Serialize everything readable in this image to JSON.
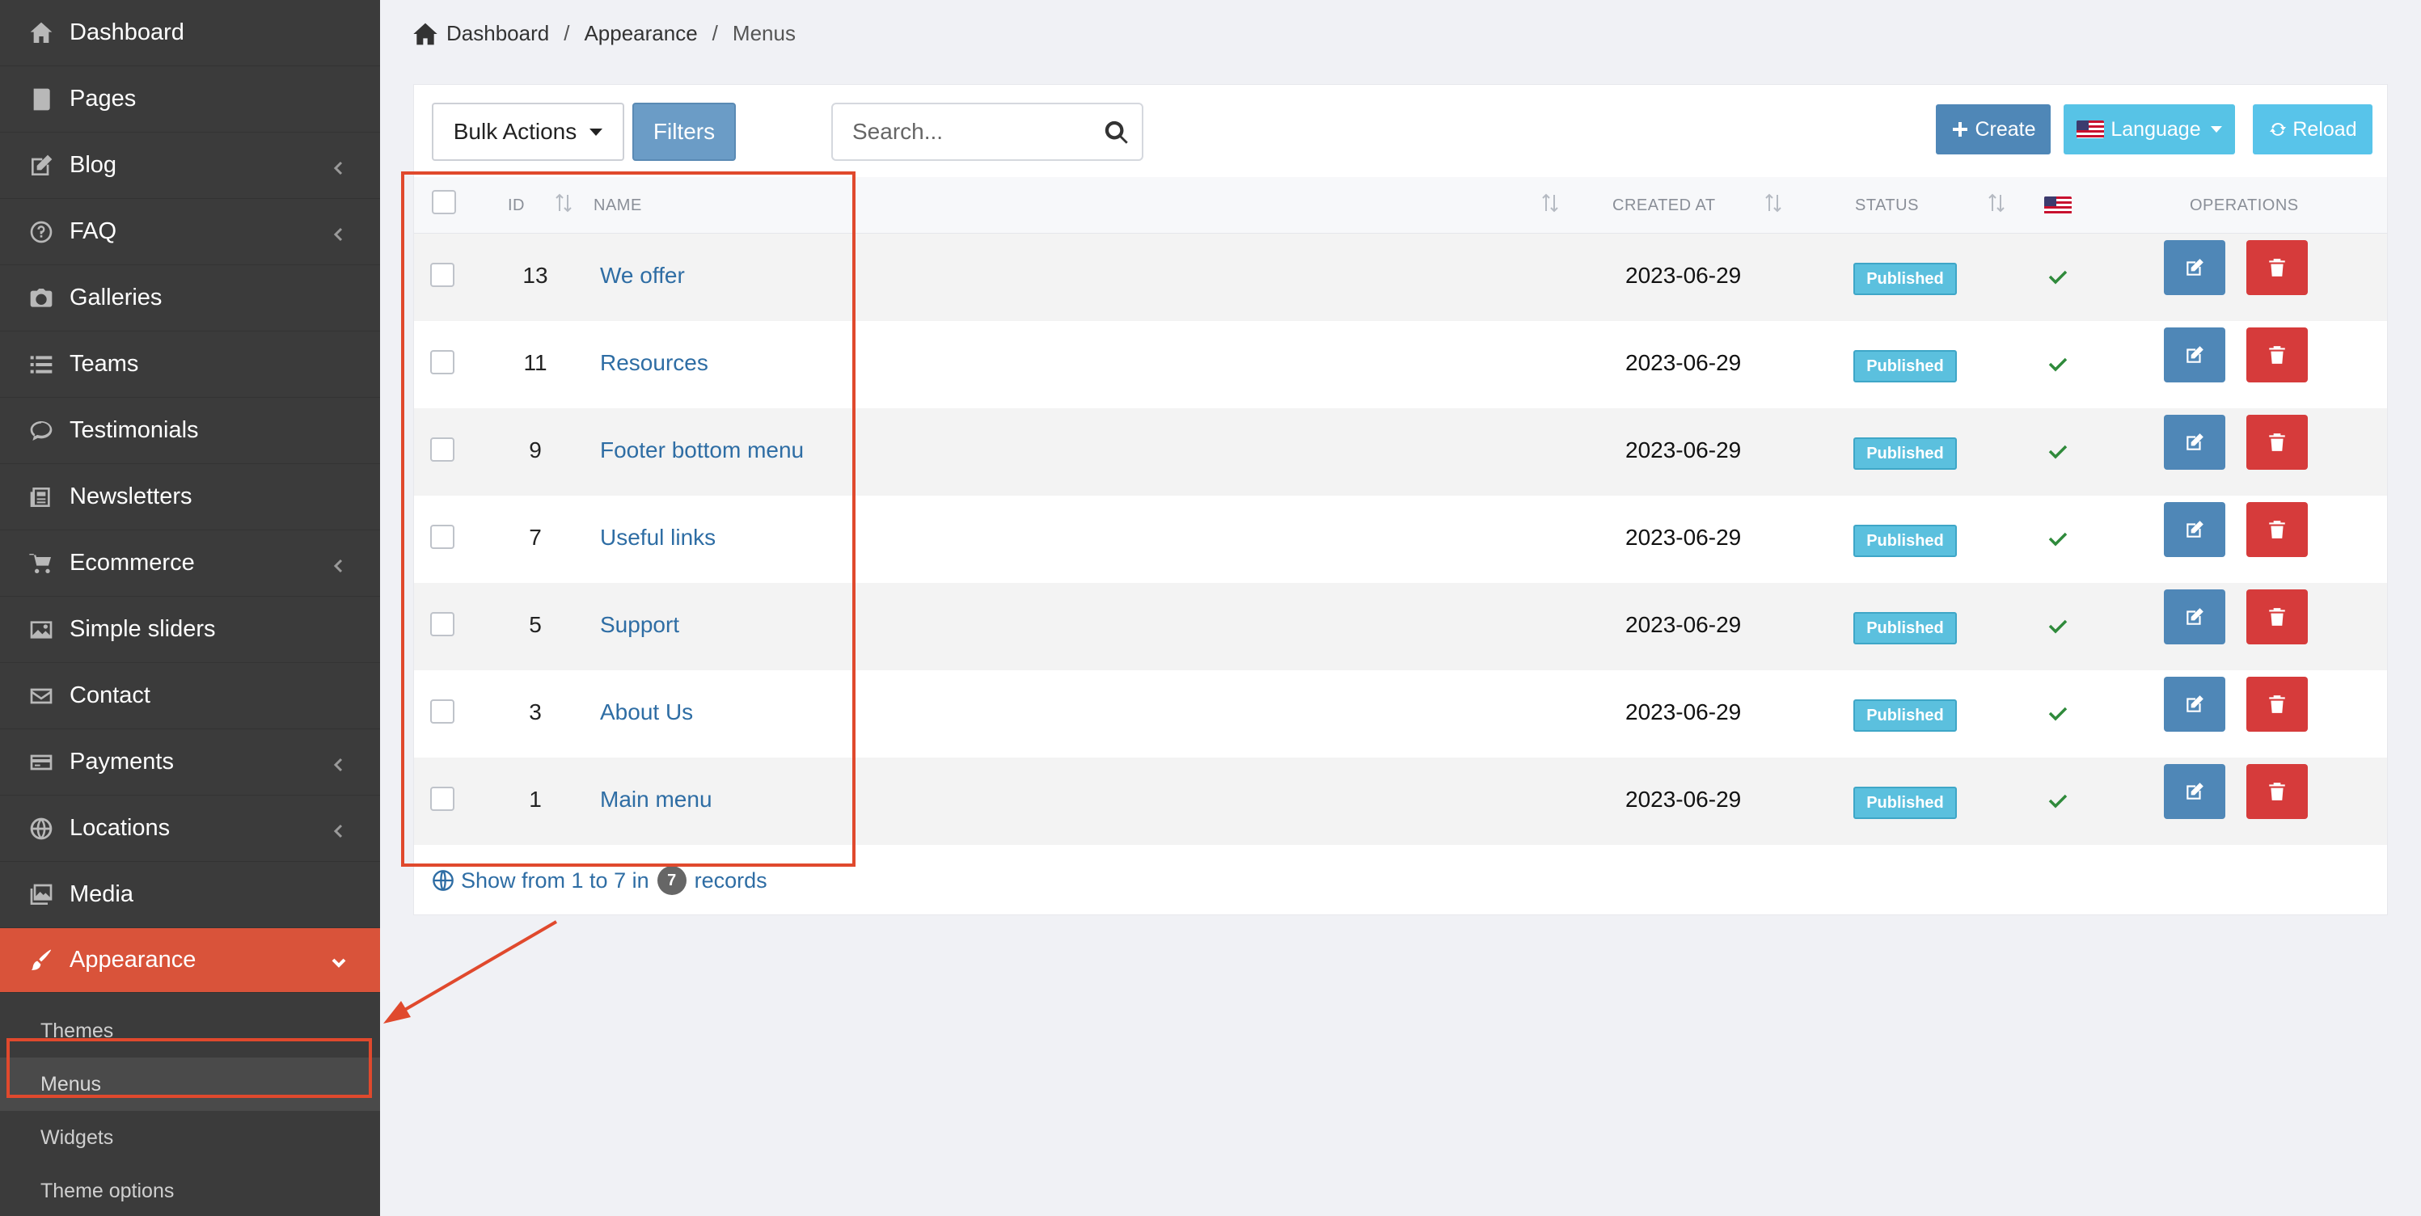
{
  "sidebar": {
    "items": [
      {
        "label": "Dashboard",
        "icon": "home-icon",
        "has_chevron": false
      },
      {
        "label": "Pages",
        "icon": "book-icon",
        "has_chevron": false
      },
      {
        "label": "Blog",
        "icon": "edit-icon",
        "has_chevron": true
      },
      {
        "label": "FAQ",
        "icon": "question-icon",
        "has_chevron": true
      },
      {
        "label": "Galleries",
        "icon": "camera-icon",
        "has_chevron": false
      },
      {
        "label": "Teams",
        "icon": "list-icon",
        "has_chevron": false
      },
      {
        "label": "Testimonials",
        "icon": "comment-icon",
        "has_chevron": false
      },
      {
        "label": "Newsletters",
        "icon": "newspaper-icon",
        "has_chevron": false
      },
      {
        "label": "Ecommerce",
        "icon": "cart-icon",
        "has_chevron": true
      },
      {
        "label": "Simple sliders",
        "icon": "image-icon",
        "has_chevron": false
      },
      {
        "label": "Contact",
        "icon": "envelope-icon",
        "has_chevron": false
      },
      {
        "label": "Payments",
        "icon": "credit-card-icon",
        "has_chevron": true
      },
      {
        "label": "Locations",
        "icon": "globe-icon",
        "has_chevron": true
      },
      {
        "label": "Media",
        "icon": "images-icon",
        "has_chevron": false
      },
      {
        "label": "Appearance",
        "icon": "paintbrush-icon",
        "has_chevron": true,
        "active": true
      }
    ],
    "submenu": [
      {
        "label": "Themes"
      },
      {
        "label": "Menus",
        "selected": true
      },
      {
        "label": "Widgets"
      },
      {
        "label": "Theme options"
      }
    ]
  },
  "breadcrumb": {
    "home": "Dashboard",
    "parent": "Appearance",
    "current": "Menus",
    "separator": "/"
  },
  "toolbar": {
    "bulk_label": "Bulk Actions",
    "filters_label": "Filters",
    "search_placeholder": "Search...",
    "create_label": "Create",
    "language_label": "Language",
    "reload_label": "Reload"
  },
  "table": {
    "headers": {
      "id": "ID",
      "name": "NAME",
      "created_at": "CREATED AT",
      "status": "STATUS",
      "operations": "OPERATIONS"
    },
    "rows": [
      {
        "id": "13",
        "name": "We offer",
        "created_at": "2023-06-29",
        "status": "Published"
      },
      {
        "id": "11",
        "name": "Resources",
        "created_at": "2023-06-29",
        "status": "Published"
      },
      {
        "id": "9",
        "name": "Footer bottom menu",
        "created_at": "2023-06-29",
        "status": "Published"
      },
      {
        "id": "7",
        "name": "Useful links",
        "created_at": "2023-06-29",
        "status": "Published"
      },
      {
        "id": "5",
        "name": "Support",
        "created_at": "2023-06-29",
        "status": "Published"
      },
      {
        "id": "3",
        "name": "About Us",
        "created_at": "2023-06-29",
        "status": "Published"
      },
      {
        "id": "1",
        "name": "Main menu",
        "created_at": "2023-06-29",
        "status": "Published"
      }
    ]
  },
  "footer": {
    "prefix": "Show from 1 to 7 in",
    "count": "7",
    "suffix": "records"
  },
  "colors": {
    "active": "#d9533a",
    "link": "#2e6da4",
    "badge": "#5bc0de",
    "annotation": "#e0492d"
  }
}
